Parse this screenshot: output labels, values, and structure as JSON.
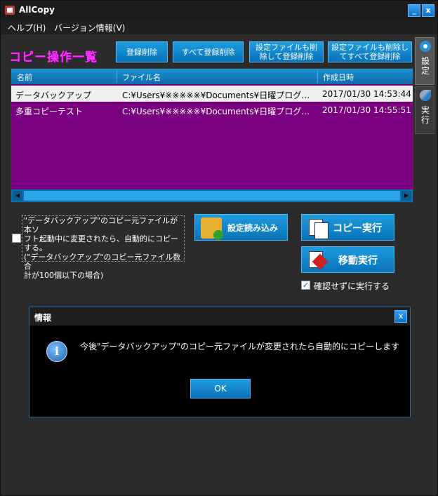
{
  "window": {
    "title": "AllCopy",
    "min_label": "_",
    "close_label": "x"
  },
  "menu": {
    "items": [
      "ヘルプ(H)",
      "バージョン情報(V)"
    ]
  },
  "heading": "コピー操作一覧",
  "toolbar": {
    "delete_entry": "登録削除",
    "delete_all": "すべて登録削除",
    "delete_with_settings_line1": "設定ファイルも削",
    "delete_with_settings_line2": "除して登録削除",
    "delete_all_with_settings_line1": "設定ファイルも削除し",
    "delete_all_with_settings_line2": "てすべて登録削除"
  },
  "table": {
    "columns": [
      "名前",
      "ファイル名",
      "作成日時"
    ],
    "rows": [
      {
        "name": "データバックアップ",
        "file": "C:¥Users¥※※※※※¥Documents¥日曜プログ…",
        "created": "2017/01/30 14:53:44",
        "selected": true
      },
      {
        "name": "多重コピーテスト",
        "file": "C:¥Users¥※※※※※¥Documents¥日曜プログ…",
        "created": "2017/01/30 14:55:51",
        "selected": false
      }
    ],
    "scroll_left": "◀",
    "scroll_right": "▶"
  },
  "auto_copy": {
    "checked": false,
    "text_line1": "\"データバックアップ\"のコピー元ファイルが本ソ",
    "text_line2": "フト起動中に変更されたら、自動的にコピー",
    "text_line3": "する。",
    "text_line4": "(\"データバックアップ\"のコピー元ファイル数合",
    "text_line5": "計が100個以下の場合)"
  },
  "actions": {
    "load_settings": "設定読み込み",
    "copy_run": "コピー実行",
    "move_run": "移動実行",
    "no_confirm_label": "確認せずに実行する",
    "no_confirm_checked": true,
    "check_mark": "✓"
  },
  "sidebar": {
    "tabs": [
      {
        "label": "設定",
        "icon": "gear-icon",
        "active": true
      },
      {
        "label": "実行",
        "icon": "rocket-icon",
        "active": false
      }
    ]
  },
  "dialog": {
    "title": "情報",
    "close_label": "x",
    "icon_glyph": "i",
    "message": "今後\"データバックアップ\"のコピー元ファイルが変更されたら自動的にコピーします",
    "ok_label": "OK"
  },
  "colors": {
    "accent": "#1a8fd6",
    "heading": "#ff33ff",
    "list_bg": "#7a0080",
    "window_bg": "#2b2b2b"
  }
}
